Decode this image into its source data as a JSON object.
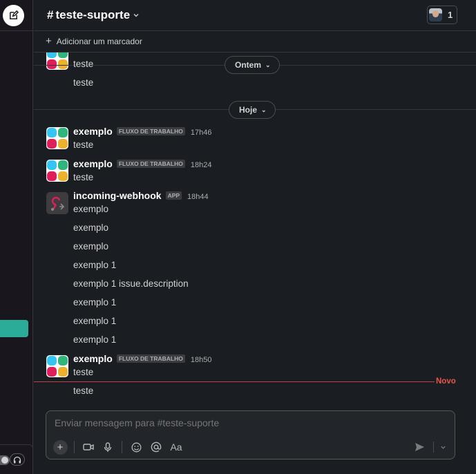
{
  "channel": {
    "hash": "#",
    "name": "teste-suporte",
    "member_count": "1"
  },
  "bookmarks": {
    "add_label": "Adicionar um marcador"
  },
  "dividers": {
    "yesterday": "Ontem",
    "today": "Hoje",
    "new": "Novo"
  },
  "messages_yesterday": {
    "text_1": "teste",
    "text_2": "teste"
  },
  "messages_today": [
    {
      "sender": "exemplo",
      "tag": "FLUXO DE TRABALHO",
      "time": "17h46",
      "text": "teste"
    },
    {
      "sender": "exemplo",
      "tag": "FLUXO DE TRABALHO",
      "time": "18h24",
      "text": "teste"
    },
    {
      "sender": "incoming-webhook",
      "tag": "APP",
      "time": "18h44",
      "lines": [
        "exemplo",
        "exemplo",
        "exemplo",
        "exemplo 1",
        "exemplo 1 issue.description",
        "exemplo 1",
        "exemplo 1",
        "exemplo 1"
      ]
    },
    {
      "sender": "exemplo",
      "tag": "FLUXO DE TRABALHO",
      "time": "18h50",
      "text": "teste",
      "extra_line": "teste"
    }
  ],
  "composer": {
    "placeholder": "Enviar mensagem para #teste-suporte",
    "format_label": "Aa"
  },
  "icons": {
    "compose": "compose-icon",
    "chevron": "chevron-down-icon",
    "plus": "plus-icon",
    "video": "video-icon",
    "mic": "microphone-icon",
    "emoji": "emoji-icon",
    "mention": "mention-icon",
    "send": "send-icon",
    "headphones": "headphones-icon"
  },
  "colors": {
    "accent": "#2bac98",
    "new_divider": "#c1404a",
    "background": "#1a1d21"
  }
}
